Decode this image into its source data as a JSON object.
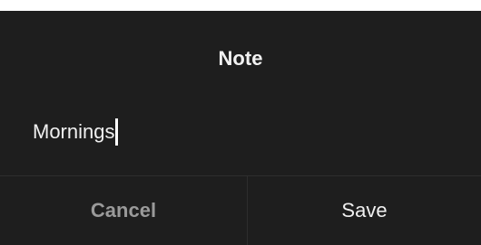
{
  "dialog": {
    "title": "Note",
    "input": {
      "value": "Mornings"
    },
    "buttons": {
      "cancel_label": "Cancel",
      "save_label": "Save"
    }
  },
  "colors": {
    "background": "#1e1e1e",
    "text": "#f0f0f0",
    "cancel_text": "#9a9a9a",
    "divider": "#2e2e2e"
  }
}
